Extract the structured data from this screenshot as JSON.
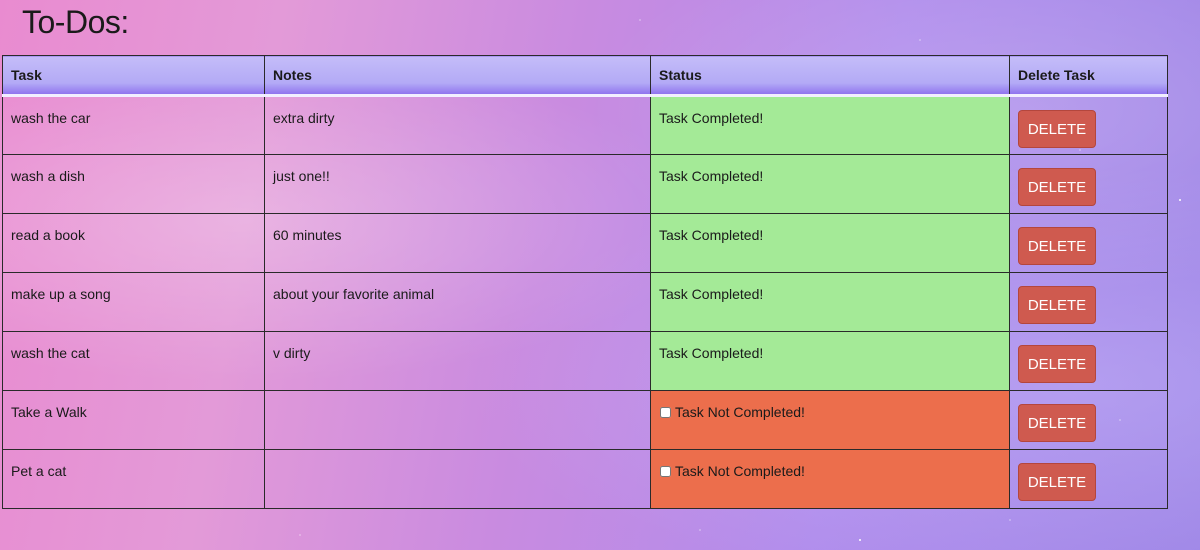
{
  "page": {
    "title": "To-Dos:"
  },
  "table": {
    "headers": [
      "Task",
      "Notes",
      "Status",
      "Delete Task"
    ],
    "rows": [
      {
        "task": "wash the car",
        "notes": "extra dirty",
        "status": "Task Completed!",
        "completed": true,
        "delete_label": "DELETE"
      },
      {
        "task": "wash a dish",
        "notes": "just one!!",
        "status": "Task Completed!",
        "completed": true,
        "delete_label": "DELETE"
      },
      {
        "task": "read a book",
        "notes": "60 minutes",
        "status": "Task Completed!",
        "completed": true,
        "delete_label": "DELETE"
      },
      {
        "task": "make up a song",
        "notes": "about your favorite animal",
        "status": "Task Completed!",
        "completed": true,
        "delete_label": "DELETE"
      },
      {
        "task": "wash the cat",
        "notes": "v dirty",
        "status": "Task Completed!",
        "completed": true,
        "delete_label": "DELETE"
      },
      {
        "task": "Take a Walk",
        "notes": "",
        "status": "Task Not Completed!",
        "completed": false,
        "delete_label": "DELETE"
      },
      {
        "task": "Pet a cat",
        "notes": "",
        "status": "Task Not Completed!",
        "completed": false,
        "delete_label": "DELETE"
      }
    ]
  },
  "colors": {
    "completed": "#a4ea97",
    "not_completed": "#ec6e4c",
    "delete_button": "#cf5a4f",
    "header_accent": "#b3aaf6"
  }
}
